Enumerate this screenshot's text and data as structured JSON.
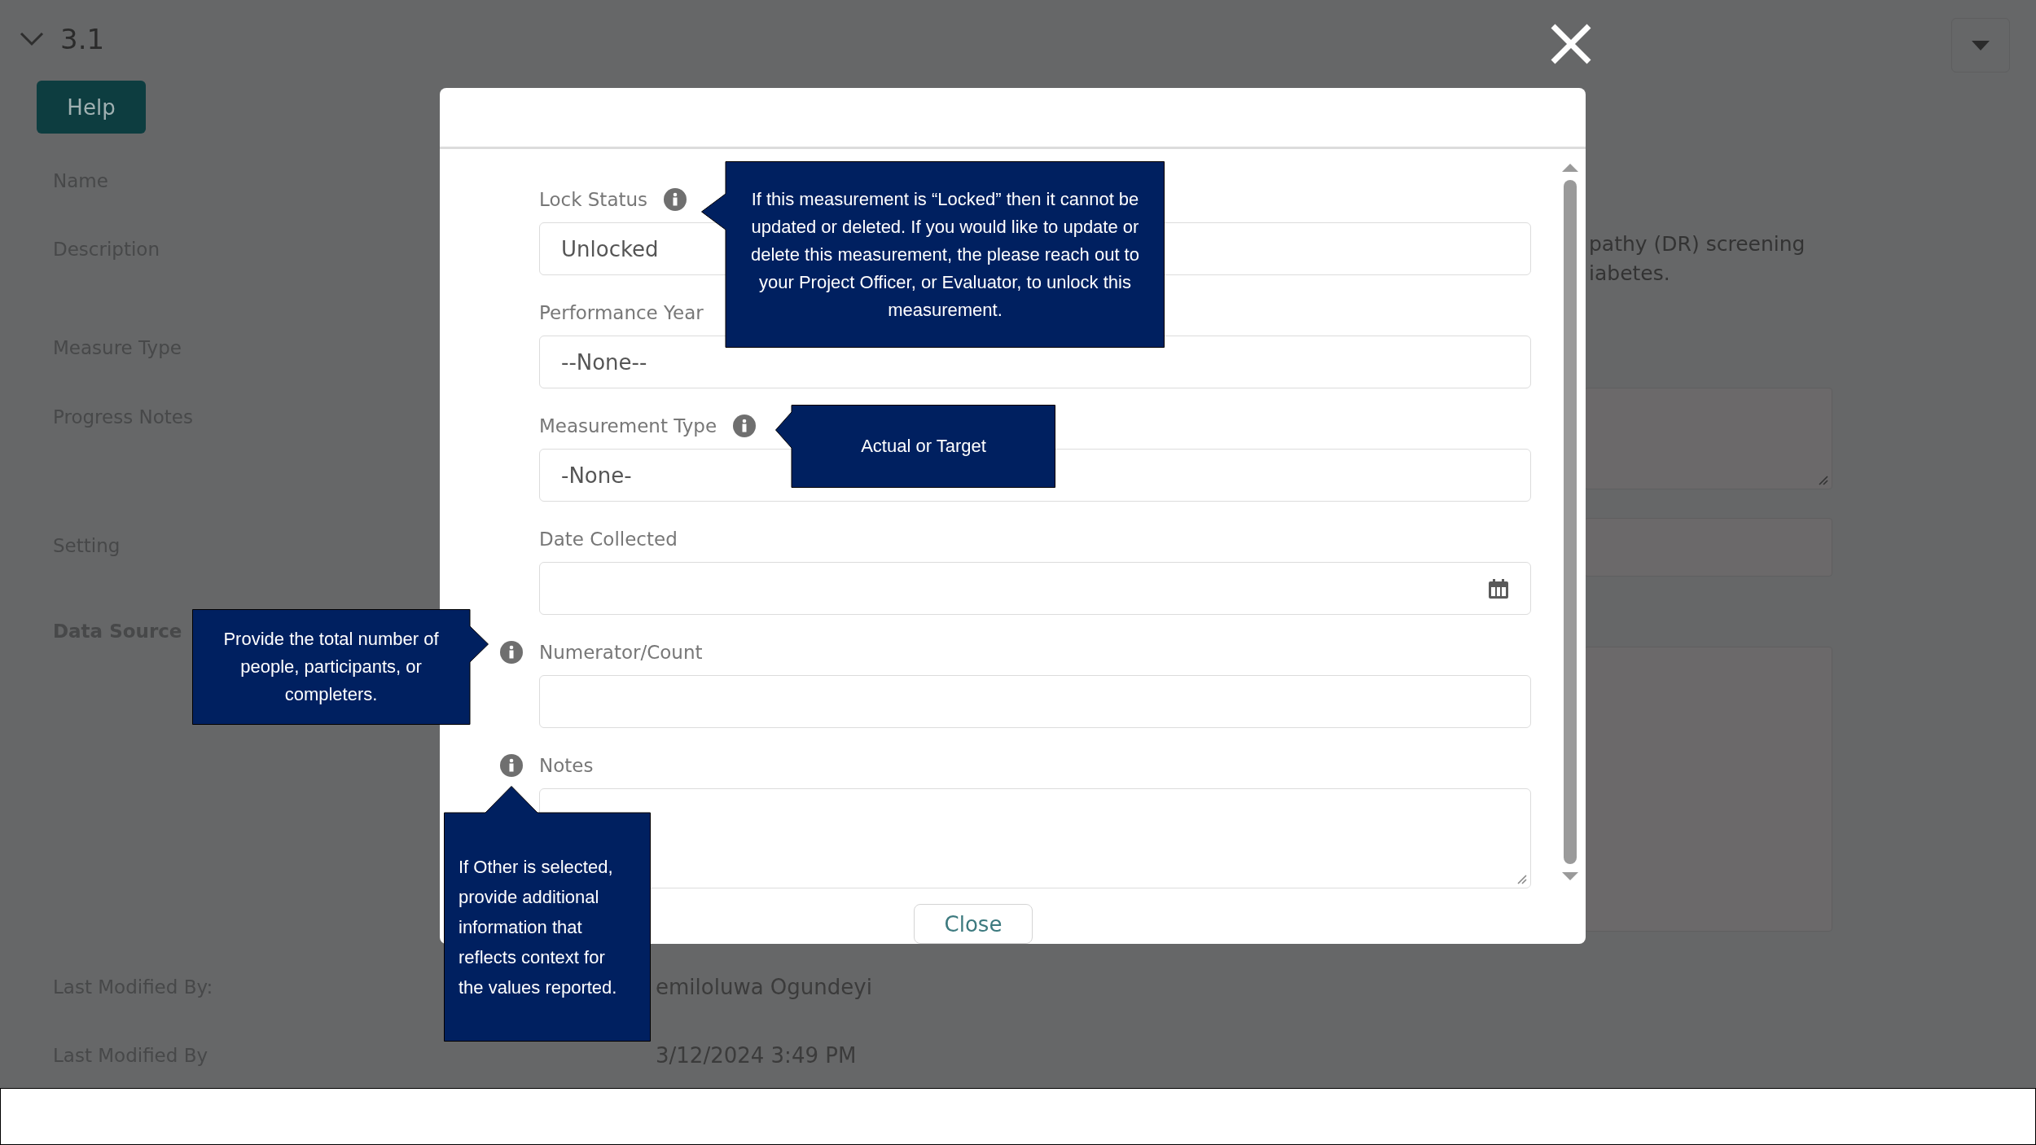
{
  "page": {
    "section_title": "3.1",
    "help_button": "Help",
    "labels": [
      {
        "text": "Name",
        "emphasized": false
      },
      {
        "text": "Description",
        "emphasized": false
      },
      {
        "text": "Measure Type",
        "emphasized": false
      },
      {
        "text": "Progress Notes",
        "emphasized": false
      },
      {
        "text": "Setting",
        "emphasized": false
      },
      {
        "text": "Data Source",
        "emphasized": true
      }
    ],
    "footer_rows": [
      {
        "label": "Last Modified By:",
        "value": "emiloluwa Ogundeyi"
      },
      {
        "label": "Last Modified By",
        "value": "3/12/2024 3:49 PM"
      }
    ],
    "description_lines": [
      "pathy (DR) screening",
      "iabetes."
    ]
  },
  "modal": {
    "fields": [
      {
        "label": "Lock Status",
        "kind": "select",
        "value": "Unlocked",
        "has_info": true
      },
      {
        "label": "Performance Year",
        "kind": "select",
        "value": "--None--",
        "has_info": false
      },
      {
        "label": "Measurement Type",
        "kind": "select",
        "value": "-None-",
        "has_info": true
      },
      {
        "label": "Date Collected",
        "kind": "date",
        "has_info": false
      },
      {
        "label": "Numerator/Count",
        "kind": "text",
        "has_info": true
      },
      {
        "label": "Notes",
        "kind": "textarea",
        "has_info": true
      }
    ],
    "close_button": "Close"
  },
  "callouts": [
    {
      "text": "If this measurement is “Locked” then it cannot be updated or deleted. If you would like to update or delete this measurement, the please reach out to your Project Officer, or Evaluator, to unlock this measurement.",
      "kind": "left"
    },
    {
      "text": "Actual or Target",
      "kind": "left"
    },
    {
      "text": "Provide the total number of people, participants, or completers.",
      "kind": "right"
    },
    {
      "text": "If Other is selected, provide additional information that reflects context for the values reported.",
      "kind": "up"
    }
  ]
}
